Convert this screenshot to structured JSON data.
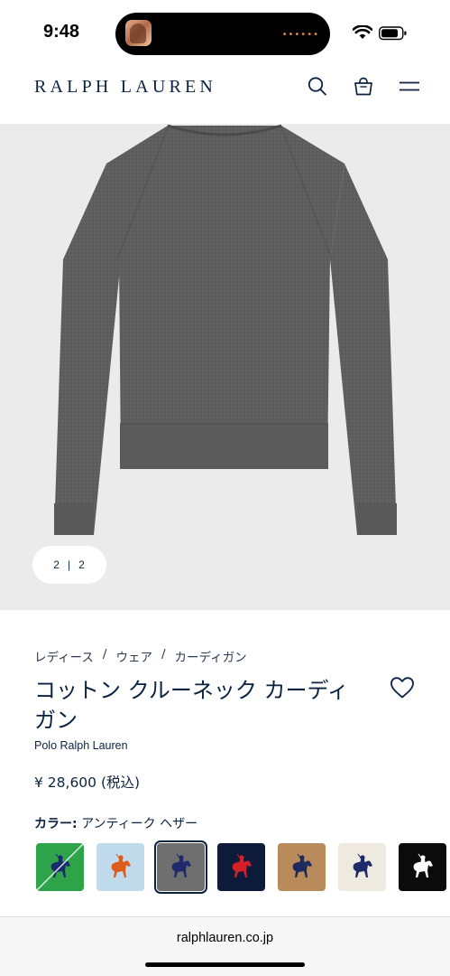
{
  "status_bar": {
    "time": "9:48",
    "island_dots": "••••••"
  },
  "nav": {
    "logo": "RALPH LAUREN"
  },
  "gallery": {
    "current": "2",
    "separator": "|",
    "total": "2"
  },
  "product": {
    "breadcrumb": [
      "レディース",
      "ウェア",
      "カーディガン"
    ],
    "breadcrumb_separator": "/",
    "title": "コットン クルーネック カーディガン",
    "brand": "Polo Ralph Lauren",
    "price": "¥ 28,600 (税込)",
    "color_label": "カラー:",
    "color_value": "アンティーク ヘザー"
  },
  "swatches": [
    {
      "name": "green",
      "bg": "#2fa34a",
      "pony": "#1a2a6e",
      "strike": true
    },
    {
      "name": "light-blue",
      "bg": "#bfdbec",
      "pony": "#e05a1c"
    },
    {
      "name": "antique-heather",
      "bg": "#6f6f70",
      "pony": "#1e2a6a",
      "selected": true
    },
    {
      "name": "navy",
      "bg": "#0e1a3a",
      "pony": "#d32029"
    },
    {
      "name": "camel",
      "bg": "#b98b5a",
      "pony": "#1e2a5e"
    },
    {
      "name": "cream",
      "bg": "#efeadf",
      "pony": "#1e2a6a"
    },
    {
      "name": "black",
      "bg": "#0b0b0b",
      "pony": "#ffffff"
    }
  ],
  "browser": {
    "url": "ralphlauren.co.jp"
  }
}
